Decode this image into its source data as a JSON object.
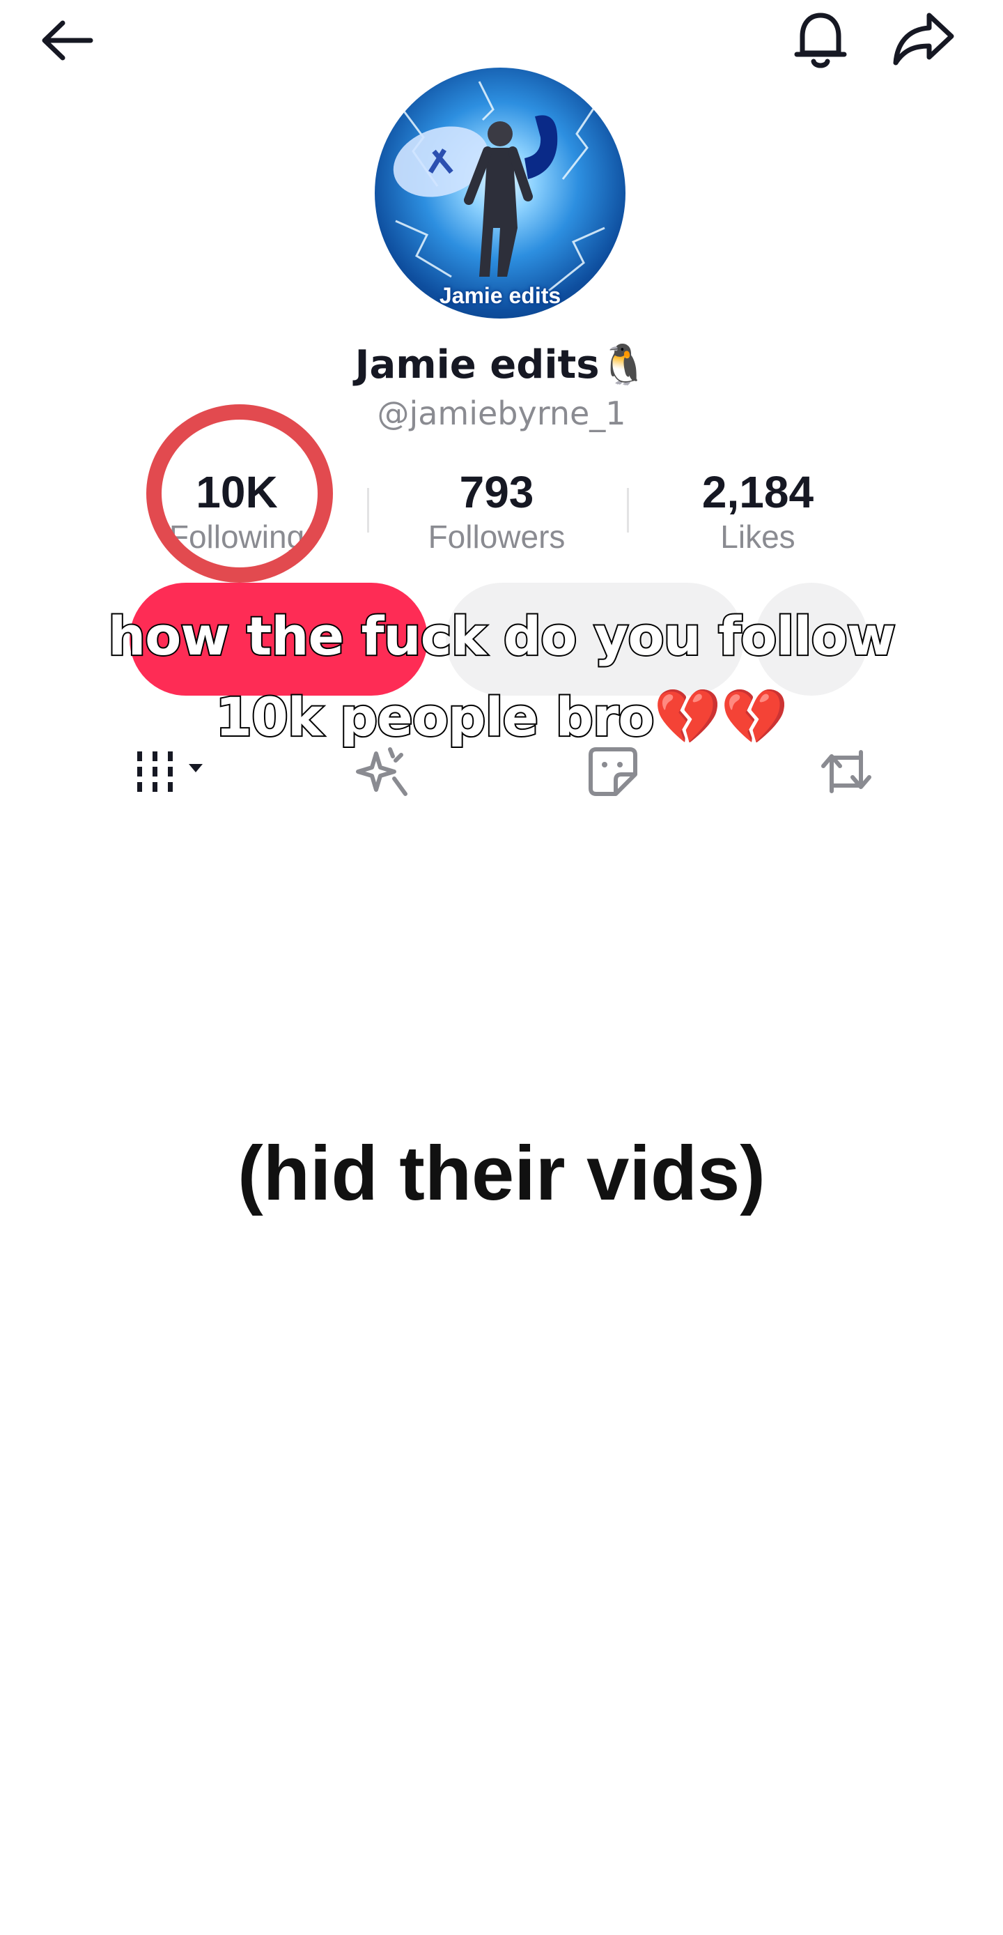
{
  "header": {
    "back_icon": "arrow-left-icon",
    "notification_icon": "bell-icon",
    "share_icon": "share-icon"
  },
  "profile": {
    "avatar_caption": "Jamie edits",
    "display_name": "Jamie edits🐧",
    "username": "@jamiebyrne_1"
  },
  "stats": {
    "following_count": "10K",
    "following_label": "Following",
    "followers_count": "793",
    "followers_label": "Followers",
    "likes_count": "2,184",
    "likes_label": "Likes"
  },
  "overlay": {
    "caption_line1": "how the fuck do you follow",
    "caption_line2_text": "10k people bro",
    "caption_line2_emoji": "💔💔",
    "hidden_note": "(hid their vids)"
  },
  "tabs": {
    "videos_icon": "grid-columns-icon",
    "favorites_icon": "sparkle-icon",
    "stickers_icon": "sticker-icon",
    "reposts_icon": "repost-icon"
  },
  "colors": {
    "accent": "#fe2c55",
    "circle_mark": "#e24a4f",
    "secondary_button": "#f1f1f2",
    "muted_text": "#8a8b91"
  }
}
